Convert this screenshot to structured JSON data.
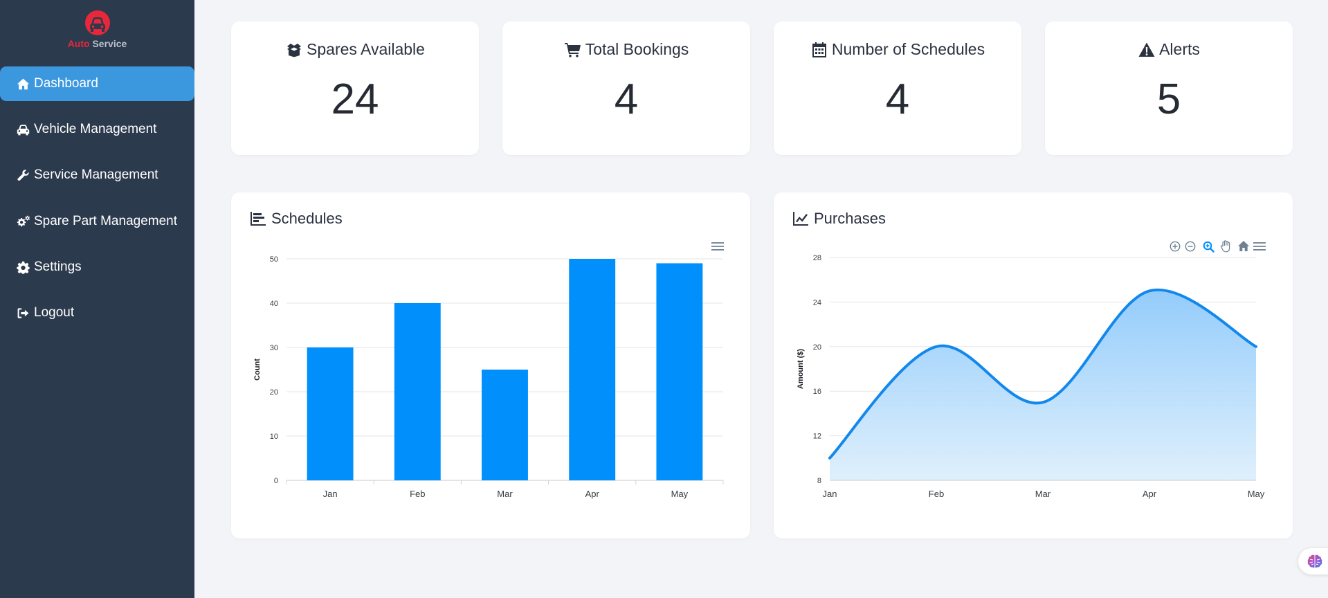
{
  "app": {
    "brand_auto": "Auto",
    "brand_service": "Service",
    "logo_icon": "car-front-icon",
    "accent": "#3b97de",
    "brand_red": "#e6283a"
  },
  "sidebar": {
    "items": [
      {
        "label": "Dashboard",
        "icon": "home-icon",
        "active": true
      },
      {
        "label": "Vehicle Management",
        "icon": "car-icon"
      },
      {
        "label": "Service Management",
        "icon": "wrench-icon"
      },
      {
        "label": "Spare Part Management",
        "icon": "gears-icon"
      },
      {
        "label": "Settings",
        "icon": "gear-icon"
      },
      {
        "label": "Logout",
        "icon": "sign-out-icon"
      }
    ]
  },
  "stats": [
    {
      "label": "Spares Available",
      "value": "24",
      "icon": "box-icon"
    },
    {
      "label": "Total Bookings",
      "value": "4",
      "icon": "cart-icon"
    },
    {
      "label": "Number of Schedules",
      "value": "4",
      "icon": "calendar-icon"
    },
    {
      "label": "Alerts",
      "value": "5",
      "icon": "warning-icon"
    }
  ],
  "schedules_panel": {
    "title": "Schedules",
    "icon": "bar-chart-icon",
    "menu_icon": "hamburger-menu-icon"
  },
  "purchases_panel": {
    "title": "Purchases",
    "icon": "line-chart-icon",
    "toolbar": [
      "zoom-in-icon",
      "zoom-out-icon",
      "selection-zoom-icon",
      "pan-hand-icon",
      "reset-home-icon",
      "hamburger-menu-icon"
    ]
  },
  "chart_data": [
    {
      "type": "bar",
      "categories": [
        "Jan",
        "Feb",
        "Mar",
        "Apr",
        "May"
      ],
      "values": [
        30,
        40,
        25,
        50,
        49
      ],
      "title": "",
      "xlabel": "",
      "ylabel": "Count",
      "ylim": [
        0,
        50
      ],
      "yticks": [
        0,
        10,
        20,
        30,
        40,
        50
      ],
      "grid": true,
      "color": "#008ffb"
    },
    {
      "type": "area",
      "categories": [
        "Jan",
        "Feb",
        "Mar",
        "Apr",
        "May"
      ],
      "values": [
        10,
        20,
        15,
        25,
        20
      ],
      "title": "",
      "xlabel": "",
      "ylabel": "Amount ($)",
      "ylim": [
        8,
        28
      ],
      "yticks": [
        8,
        12,
        16,
        20,
        24,
        28
      ],
      "grid": true,
      "smooth": true,
      "color": "#1388ec"
    }
  ]
}
